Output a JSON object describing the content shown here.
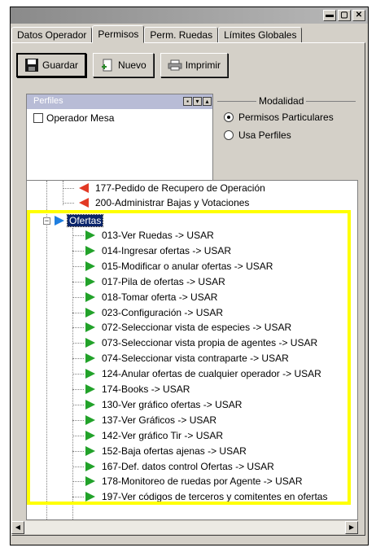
{
  "window": {
    "controls": [
      "▬",
      "▢",
      "✕"
    ]
  },
  "tabs": [
    {
      "label": "Datos Operador",
      "active": false
    },
    {
      "label": "Permisos",
      "active": true
    },
    {
      "label": "Perm. Ruedas",
      "active": false
    },
    {
      "label": "Límites Globales",
      "active": false
    }
  ],
  "toolbar": {
    "save_label": "Guardar",
    "new_label": "Nuevo",
    "print_label": "Imprimir"
  },
  "perfiles": {
    "header": "Perfiles",
    "item": "Operador Mesa",
    "item_checked": false
  },
  "modalidad": {
    "title": "Modalidad",
    "options": [
      {
        "label": "Permisos Particulares",
        "selected": true
      },
      {
        "label": "Usa Perfiles",
        "selected": false
      }
    ]
  },
  "tree": {
    "top_items": [
      {
        "label": "177-Pedido de Recupero de Operación",
        "icon": "red-arrow"
      },
      {
        "label": "200-Administrar Bajas y Votaciones",
        "icon": "red-arrow"
      }
    ],
    "node": {
      "label": "Ofertas",
      "expanded": true,
      "selected": true
    },
    "children": [
      "013-Ver Ruedas -> USAR",
      "014-Ingresar ofertas -> USAR",
      "015-Modificar o anular ofertas -> USAR",
      "017-Pila de ofertas -> USAR",
      "018-Tomar oferta -> USAR",
      "023-Configuración -> USAR",
      "072-Seleccionar vista de especies -> USAR",
      "073-Seleccionar vista propia de agentes -> USAR",
      "074-Seleccionar vista contraparte -> USAR",
      "124-Anular ofertas de cualquier operador -> USAR",
      "174-Books -> USAR",
      "130-Ver gráfico ofertas -> USAR",
      "137-Ver Gráficos -> USAR",
      "142-Ver gráfico Tir -> USAR",
      "152-Baja ofertas ajenas -> USAR",
      "167-Def. datos control Ofertas -> USAR",
      "178-Monitoreo de ruedas por Agente -> USAR",
      "197-Ver códigos de terceros y comitentes en ofertas"
    ]
  },
  "colors": {
    "highlight": "#ffff00",
    "selection": "#0a246a",
    "green_arrow": "#22a22a",
    "red_arrow": "#e23a25",
    "blue_arrow": "#1f7fe0"
  }
}
